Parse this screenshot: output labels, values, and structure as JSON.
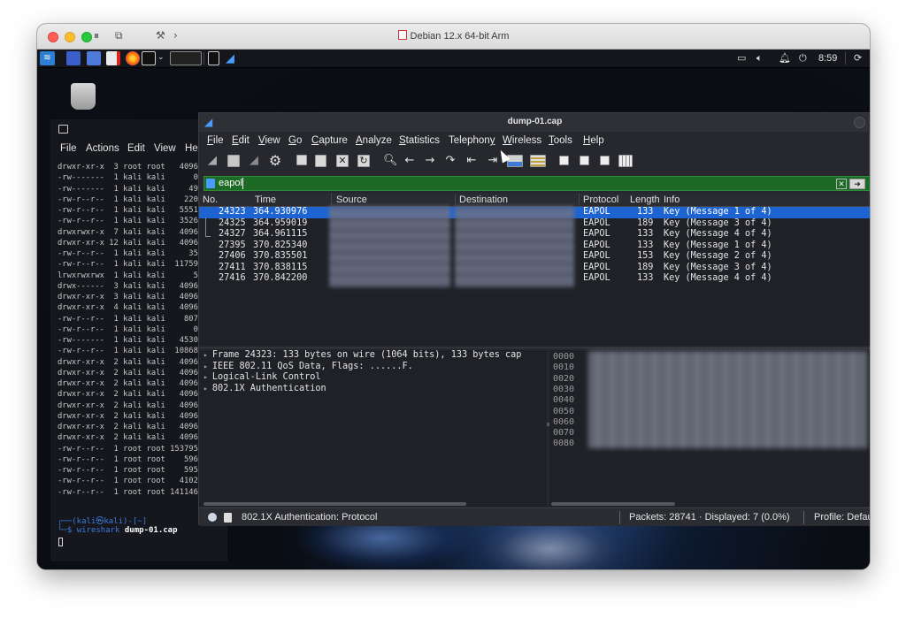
{
  "mac_window": {
    "title": "Debian 12.x 64-bit Arm"
  },
  "panel": {
    "time": "8:59"
  },
  "terminal": {
    "menu": [
      "File",
      "Actions",
      "Edit",
      "View",
      "He"
    ],
    "lines": [
      "drwxr-xr-x  3 root root   4096",
      "-rw-------  1 kali kali      0",
      "-rw-------  1 kali kali     49",
      "-rw-r--r--  1 kali kali    220",
      "-rw-r--r--  1 kali kali   5551",
      "-rw-r--r--  1 kali kali   3526",
      "drwxrwxr-x  7 kali kali   4096",
      "drwxr-xr-x 12 kali kali   4096",
      "-rw-r--r--  1 kali kali     35",
      "-rw-r--r--  1 kali kali  11759",
      "lrwxrwxrwx  1 kali kali      5",
      "drwx------  3 kali kali   4096",
      "drwxr-xr-x  3 kali kali   4096",
      "drwxr-xr-x  4 kali kali   4096",
      "-rw-r--r--  1 kali kali    807",
      "-rw-r--r--  1 kali kali      0",
      "-rw-------  1 kali kali   4530",
      "-rw-r--r--  1 kali kali  10868",
      "drwxr-xr-x  2 kali kali   4096",
      "drwxr-xr-x  2 kali kali   4096",
      "drwxr-xr-x  2 kali kali   4096",
      "drwxr-xr-x  2 kali kali   4096",
      "drwxr-xr-x  2 kali kali   4096",
      "drwxr-xr-x  2 kali kali   4096",
      "drwxr-xr-x  2 kali kali   4096",
      "drwxr-xr-x  2 kali kali   4096",
      "-rw-r--r--  1 root root 1537953",
      "-rw-r--r--  1 root root    596",
      "-rw-r--r--  1 root root    595",
      "-rw-r--r--  1 root root   4102",
      "-rw-r--r--  1 root root 1411460"
    ],
    "prompt_user": "┌──(kali㉿kali)-[~]",
    "prompt_symbol": "└─$",
    "prompt_cmd": "wireshark",
    "prompt_arg": "dump-01.cap"
  },
  "wireshark": {
    "title": "dump-01.cap",
    "menu": [
      {
        "pre": "",
        "u": "F",
        "post": "ile"
      },
      {
        "pre": "",
        "u": "E",
        "post": "dit"
      },
      {
        "pre": "",
        "u": "V",
        "post": "iew"
      },
      {
        "pre": "",
        "u": "G",
        "post": "o"
      },
      {
        "pre": "",
        "u": "C",
        "post": "apture"
      },
      {
        "pre": "",
        "u": "A",
        "post": "nalyze"
      },
      {
        "pre": "",
        "u": "S",
        "post": "tatistics"
      },
      {
        "pre": "Telephon",
        "u": "y",
        "post": ""
      },
      {
        "pre": "",
        "u": "W",
        "post": "ireless"
      },
      {
        "pre": "",
        "u": "T",
        "post": "ools"
      },
      {
        "pre": "",
        "u": "H",
        "post": "elp"
      }
    ],
    "filter": "eapol",
    "columns": [
      "No.",
      "Time",
      "Source",
      "Destination",
      "Protocol",
      "Length",
      "Info"
    ],
    "packets": [
      {
        "no": "24323",
        "time": "364.930976",
        "protocol": "EAPOL",
        "length": "133",
        "info": "Key (Message 1 of 4)"
      },
      {
        "no": "24325",
        "time": "364.959019",
        "protocol": "EAPOL",
        "length": "189",
        "info": "Key (Message 3 of 4)"
      },
      {
        "no": "24327",
        "time": "364.961115",
        "protocol": "EAPOL",
        "length": "133",
        "info": "Key (Message 4 of 4)"
      },
      {
        "no": "27395",
        "time": "370.825340",
        "protocol": "EAPOL",
        "length": "133",
        "info": "Key (Message 1 of 4)"
      },
      {
        "no": "27406",
        "time": "370.835501",
        "protocol": "EAPOL",
        "length": "153",
        "info": "Key (Message 2 of 4)"
      },
      {
        "no": "27411",
        "time": "370.838115",
        "protocol": "EAPOL",
        "length": "189",
        "info": "Key (Message 3 of 4)"
      },
      {
        "no": "27416",
        "time": "370.842200",
        "protocol": "EAPOL",
        "length": "133",
        "info": "Key (Message 4 of 4)"
      }
    ],
    "details": [
      "Frame 24323: 133 bytes on wire (1064 bits), 133 bytes cap",
      "IEEE 802.11 QoS Data, Flags: ......F.",
      "Logical-Link Control",
      "802.1X Authentication"
    ],
    "byte_offsets": [
      "0000",
      "0010",
      "0020",
      "0030",
      "0040",
      "0050",
      "0060",
      "0070",
      "0080"
    ],
    "status": {
      "field": "802.1X Authentication: Protocol",
      "packets": "Packets: 28741 · Displayed: 7 (0.0%)",
      "profile": "Profile: Defau"
    }
  }
}
